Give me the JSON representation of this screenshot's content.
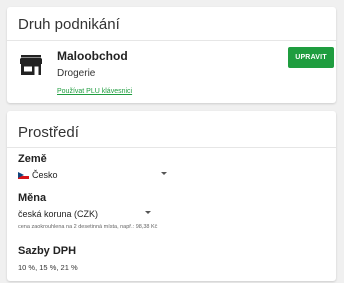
{
  "business": {
    "title": "Druh podnikání",
    "type_name": "Maloobchod",
    "type_subtitle": "Drogerie",
    "edit_button": "UPRAVIT",
    "plu_link": "Používat PLU klávesnici",
    "icon": "store-icon"
  },
  "environment": {
    "title": "Prostředí",
    "country": {
      "label": "Země",
      "value": "Česko",
      "icon": "czech-flag-icon"
    },
    "currency": {
      "label": "Měna",
      "value": "česká koruna (CZK)",
      "hint": "cena zaokrouhlena na 2 desetinná místa, např.: 98,38 Kč"
    },
    "vat": {
      "label": "Sazby DPH",
      "value": "10 %, 15 %, 21 %"
    }
  },
  "colors": {
    "accent": "#1f9d3f",
    "background": "#f0f0f0",
    "card": "#ffffff"
  }
}
